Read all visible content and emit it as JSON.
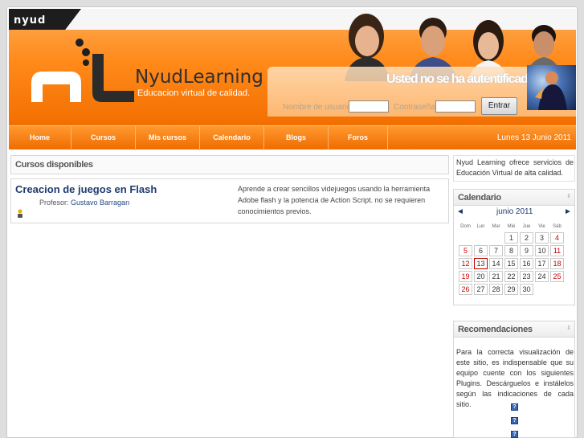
{
  "header": {
    "mini_logo": "nyud",
    "brand": "NyudLearning",
    "tagline": "Educacion virtual de calidad.",
    "not_auth": "Usted no se ha autentificado.",
    "username_label": "Nombre de usuario",
    "password_label": "Contraseña",
    "login_button": "Entrar"
  },
  "nav": {
    "items": [
      "Home",
      "Cursos",
      "Mis cursos",
      "Calendario",
      "Blogs",
      "Foros"
    ],
    "date": "Lunes 13 Junio 2011"
  },
  "courses": {
    "heading": "Cursos disponibles",
    "items": [
      {
        "title": "Creacion de juegos en Flash",
        "professor_label": "Profesor:",
        "professor": "Gustavo Barragan",
        "description": "Aprende a crear sencillos videjuegos usando la herramienta Adobe flash y la potencia de Action Script. no se requieren conocimientos previos."
      }
    ]
  },
  "sidebar": {
    "about": "Nyud Learning ofrece servicios de Educación Virtual de alta calidad.",
    "calendar": {
      "heading": "Calendario",
      "prev": "◄",
      "next": "►",
      "month": "junio 2011",
      "weekdays": [
        "Dom",
        "Lun",
        "Mar",
        "Mié",
        "Jue",
        "Vie",
        "Sáb"
      ],
      "leading_blanks": 3,
      "days": 30,
      "today": 13
    },
    "recomendaciones": {
      "heading": "Recomendaciones",
      "text": "Para la correcta visualización de este sitio, es indispensable que su equipo cuente con los siguientes Plugins. Descárguelos e instálelos según las indicaciones de cada sitio."
    }
  },
  "colors": {
    "orange": "#ff8a1a",
    "dark_orange": "#ef6c00",
    "link_blue": "#1f3b6e",
    "weekend_red": "#cc0000"
  },
  "icons": [
    "collapse-icon",
    "user-icon",
    "plugin-icon"
  ]
}
